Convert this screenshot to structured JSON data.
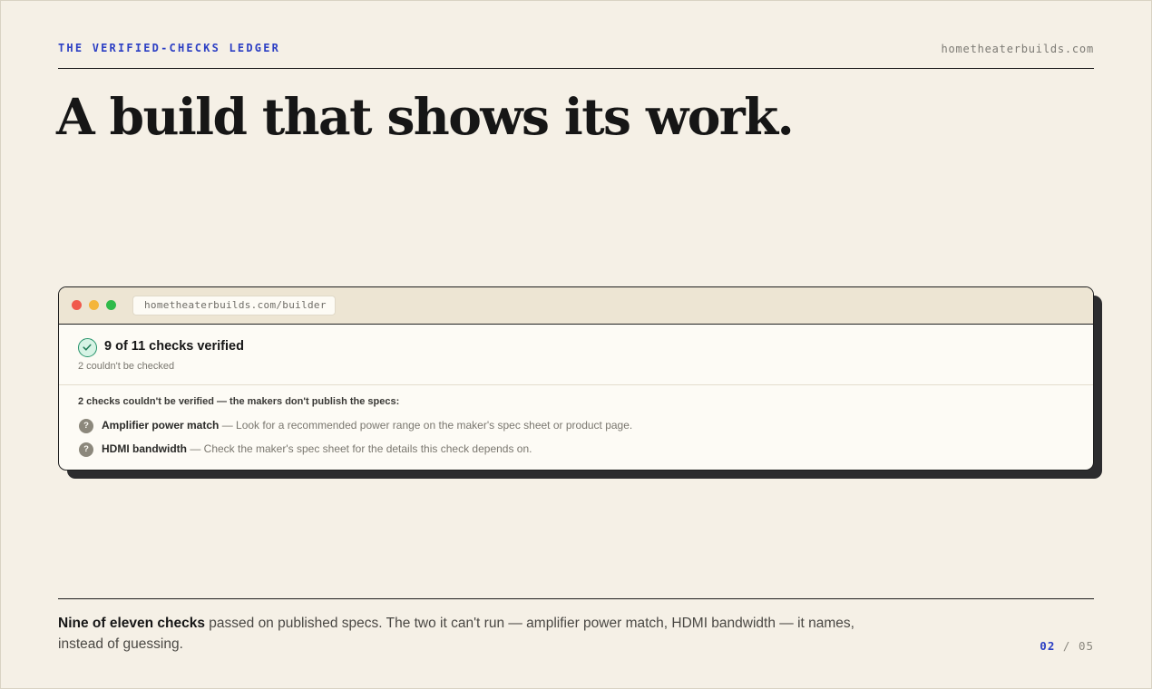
{
  "header": {
    "kicker": "THE VERIFIED-CHECKS LEDGER",
    "site": "hometheaterbuilds.com"
  },
  "headline": "A build that shows its work.",
  "browser": {
    "url": "hometheaterbuilds.com/builder",
    "status_title": "9 of 11 checks verified",
    "status_sub": "2 couldn't be checked",
    "unverified_heading": "2 checks couldn't be verified — the makers don't publish the specs:",
    "items": [
      {
        "name": "Amplifier power match",
        "desc": " — Look for a recommended power range on the maker's spec sheet or product page."
      },
      {
        "name": "HDMI bandwidth",
        "desc": " — Check the maker's spec sheet for the details this check depends on."
      }
    ],
    "unknown_glyph": "?"
  },
  "caption": {
    "lead": "Nine of eleven checks",
    "rest": " passed on published specs. The two it can't run — amplifier power match, HDMI bandwidth — it names, instead of guessing."
  },
  "pager": {
    "current": "02",
    "separator": " / ",
    "total": "05"
  },
  "colors": {
    "accent": "#2c3fc4",
    "verified": "#26936a",
    "background": "#f5f0e6"
  }
}
